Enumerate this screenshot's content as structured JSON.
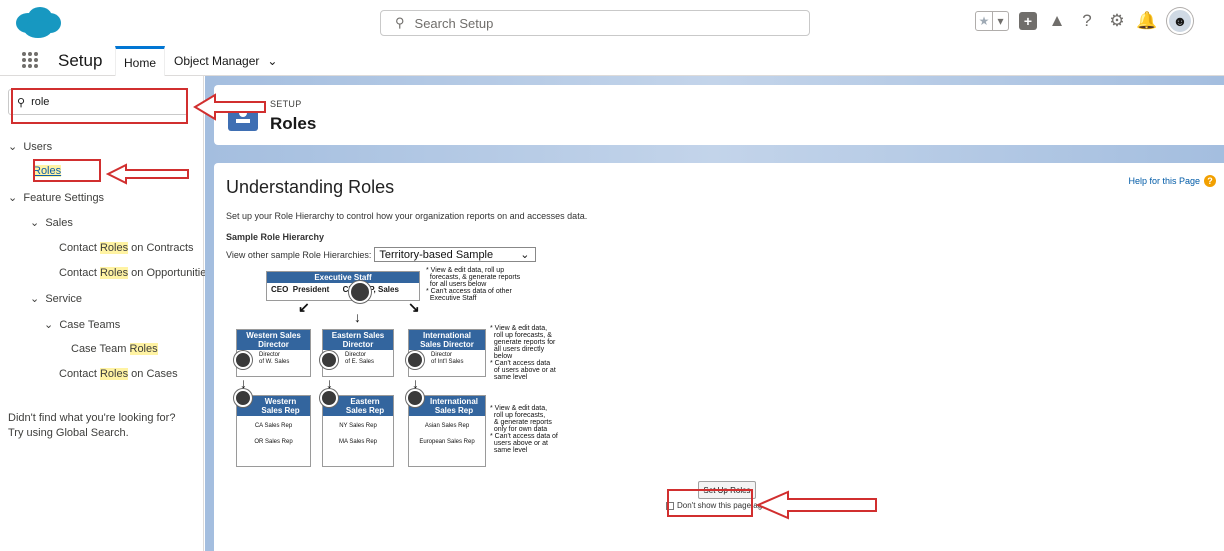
{
  "header": {
    "search_placeholder": "Search Setup",
    "icons": [
      "star-icon",
      "chevron-down-icon",
      "plus-icon",
      "trailhead-icon",
      "help-icon",
      "gear-icon",
      "bell-icon",
      "avatar-icon"
    ]
  },
  "nav": {
    "app_title": "Setup",
    "tabs": [
      {
        "label": "Home"
      },
      {
        "label": "Object Manager"
      }
    ]
  },
  "sidebar": {
    "quick_find_value": "role",
    "items": {
      "users": "Users",
      "roles": "Roles",
      "feature_settings": "Feature Settings",
      "sales": "Sales",
      "contact_roles_contracts_a": "Contact ",
      "contact_roles_contracts_b": "Roles",
      "contact_roles_contracts_c": " on Contracts",
      "contact_roles_opps_a": "Contact ",
      "contact_roles_opps_b": "Roles",
      "contact_roles_opps_c": " on Opportunities",
      "service": "Service",
      "case_teams": "Case Teams",
      "case_team_roles_a": "Case Team ",
      "case_team_roles_b": "Roles",
      "contact_roles_cases_a": "Contact ",
      "contact_roles_cases_b": "Roles",
      "contact_roles_cases_c": " on Cases"
    },
    "didnt_find_1": "Didn't find what you're looking for?",
    "didnt_find_2": "Try using Global Search."
  },
  "page_header": {
    "eyebrow": "SETUP",
    "title": "Roles"
  },
  "content": {
    "heading": "Understanding Roles",
    "help_link": "Help for this Page",
    "intro": "Set up your Role Hierarchy to control how your organization reports on and accesses data.",
    "sample_heading": "Sample Role Hierarchy",
    "view_other_label": "View other sample Role Hierarchies:",
    "sample_select_value": "Territory-based Sample",
    "setup_button": "Set Up Roles",
    "dont_show": "Don't show this page again"
  },
  "diagram": {
    "exec_title": "Executive Staff",
    "exec_members": "CEO  President      CFO  VP, Sales",
    "note_exec": "* View & edit data, roll up\n  forecasts, & generate reports\n  for all users below\n* Can't access data of other\n  Executive Staff",
    "dir_west_title": "Western Sales\nDirector",
    "dir_west_sub": "Director\nof W. Sales",
    "dir_east_title": "Eastern Sales\nDirector",
    "dir_east_sub": "Director\nof E. Sales",
    "dir_intl_title": "International\nSales Director",
    "dir_intl_sub": "Director\nof Int'l Sales",
    "note_dir": "* View & edit data,\n  roll up forecasts, &\n  generate reports for\n  all users directly\n  below\n* Can't access data\n  of users above or at\n  same level",
    "rep_west_title": "Western\nSales Rep",
    "rep_west_1": "CA Sales Rep",
    "rep_west_2": "OR Sales Rep",
    "rep_east_title": "Eastern\nSales Rep",
    "rep_east_1": "NY Sales Rep",
    "rep_east_2": "MA Sales Rep",
    "rep_intl_title": "International\nSales Rep",
    "rep_intl_1": "Asian Sales Rep",
    "rep_intl_2": "European Sales Rep",
    "note_rep": "* View & edit data,\n  roll up forecasts,\n  & generate reports\n  only for own data\n* Can't access data of\n  users above or at\n  same level"
  },
  "colors": {
    "brand": "#0176d3",
    "annotation_red": "#d12f2f",
    "highlight": "#fff3a3",
    "diagram_header": "#33659e"
  }
}
